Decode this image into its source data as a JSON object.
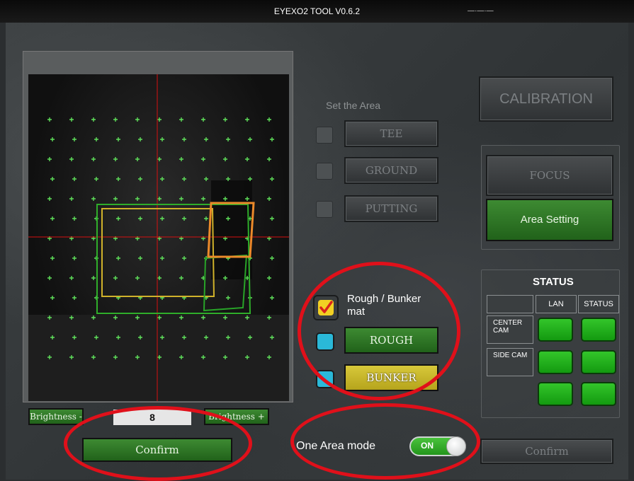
{
  "window": {
    "title": "EYEXO2 TOOL V0.6.2",
    "title_right": "—·—·—"
  },
  "camera": {
    "brightness_minus": "Brightness -",
    "brightness_value": "8",
    "brightness_plus": "Brightness +",
    "confirm": "Confirm"
  },
  "area": {
    "heading": "Set the Area",
    "buttons": [
      "TEE",
      "GROUND",
      "PUTTING"
    ]
  },
  "mat": {
    "checkbox_label": "Rough / Bunker mat",
    "checked": true,
    "rough": "ROUGH",
    "bunker": "BUNKER"
  },
  "mode": {
    "label": "One Area mode",
    "toggle": "ON"
  },
  "right": {
    "calibration": "CALIBRATION",
    "focus": "FOCUS",
    "area_setting": "Area Setting",
    "confirm": "Confirm"
  },
  "status": {
    "title": "STATUS",
    "col_lan": "LAN",
    "col_status": "STATUS",
    "rows": [
      "CENTER CAM",
      "SIDE CAM",
      ""
    ]
  },
  "colors": {
    "accent_green": "#2e7a24",
    "highlight_red": "#e0101a",
    "bunker_yellow": "#c9b62a",
    "checkbox_cyan": "#2ab8d8",
    "status_green": "#22b01c"
  }
}
